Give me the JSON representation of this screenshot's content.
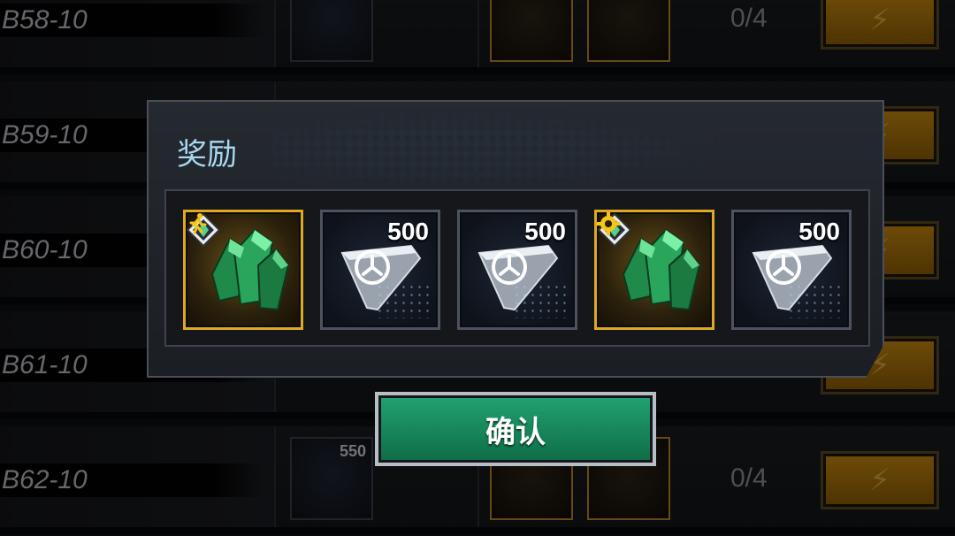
{
  "background_rows": [
    {
      "name": "B58-10",
      "progress": "0/4",
      "slot_count": ""
    },
    {
      "name": "B59-10",
      "progress": "",
      "slot_count": ""
    },
    {
      "name": "B60-10",
      "progress": "",
      "slot_count": ""
    },
    {
      "name": "B61-10",
      "progress": "",
      "slot_count": ""
    },
    {
      "name": "B62-10",
      "progress": "0/4",
      "slot_count": "550"
    }
  ],
  "modal": {
    "title": "奖励",
    "rewards": [
      {
        "type": "emerald-crystal",
        "amount": "",
        "badge_left": "crystal-rank-icon",
        "badge_right": "runner-icon",
        "rarity": "gold"
      },
      {
        "type": "silver-core",
        "amount": "500",
        "rarity": "normal"
      },
      {
        "type": "silver-core",
        "amount": "500",
        "rarity": "normal"
      },
      {
        "type": "emerald-crystal",
        "amount": "",
        "badge_left": "crystal-rank-icon",
        "badge_right": "gear-badge-icon",
        "rarity": "gold"
      },
      {
        "type": "silver-core",
        "amount": "500",
        "rarity": "normal"
      }
    ]
  },
  "confirm_label": "确认",
  "colors": {
    "gold": "#e0a820",
    "confirm_green": "#1a8f62",
    "title_blue": "#a8d8f0"
  }
}
